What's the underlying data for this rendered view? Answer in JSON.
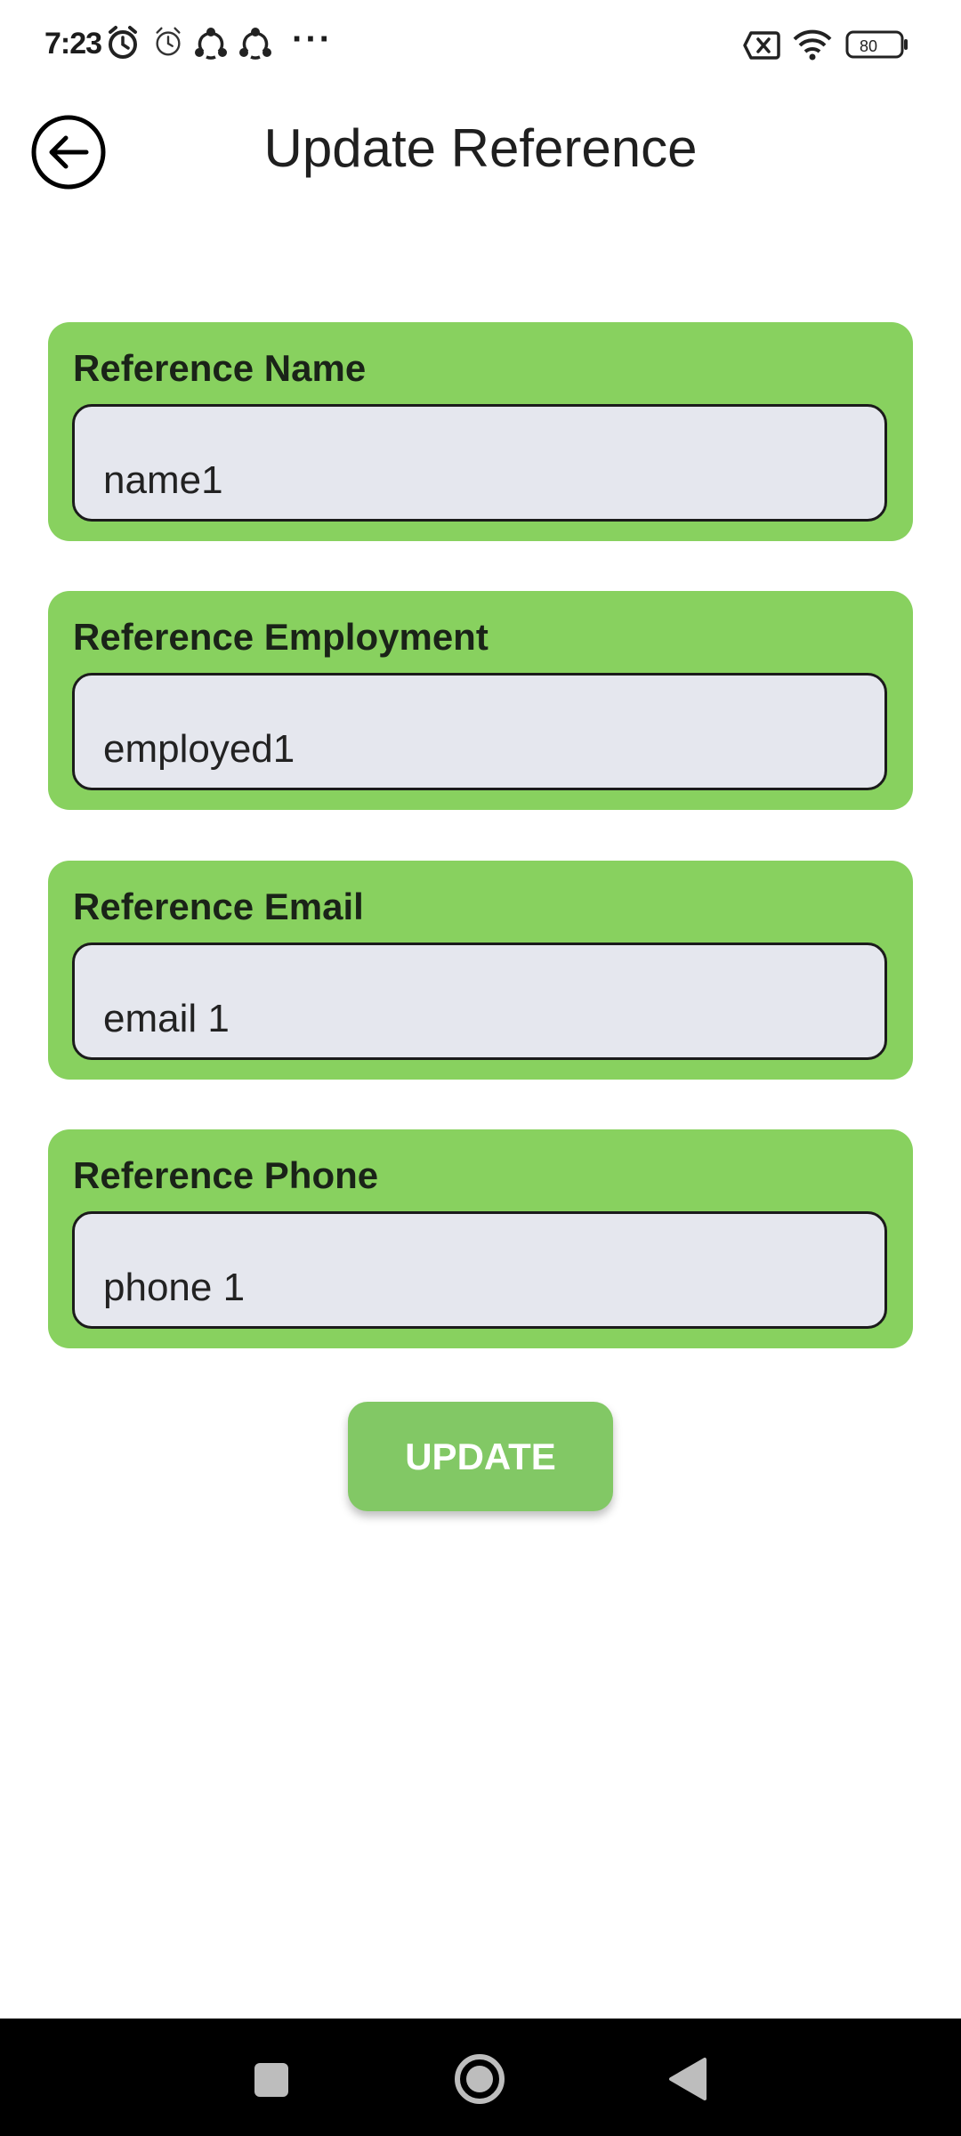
{
  "status_bar": {
    "time": "7:23",
    "more_indicator": "···",
    "icons": [
      "alarm-icon",
      "alarm-outline-icon",
      "share-app-icon",
      "share-app-icon",
      "no-sim-icon",
      "wifi-icon",
      "battery-icon"
    ],
    "battery": "80"
  },
  "header": {
    "title": "Update Reference",
    "back_icon": "arrow-left-circle-icon"
  },
  "form": {
    "fields": [
      {
        "label": "Reference Name",
        "value": "name1"
      },
      {
        "label": "Reference Employment",
        "value": "employed1"
      },
      {
        "label": "Reference Email",
        "value": "email 1"
      },
      {
        "label": "Reference Phone",
        "value": "phone 1"
      }
    ],
    "submit_label": "UPDATE"
  },
  "nav_bar": {
    "buttons": [
      "recents-square-icon",
      "home-circle-icon",
      "back-triangle-icon"
    ]
  },
  "colors": {
    "card_green": "#88d15f",
    "button_green": "#82c865",
    "input_bg": "#e5e7ee"
  }
}
